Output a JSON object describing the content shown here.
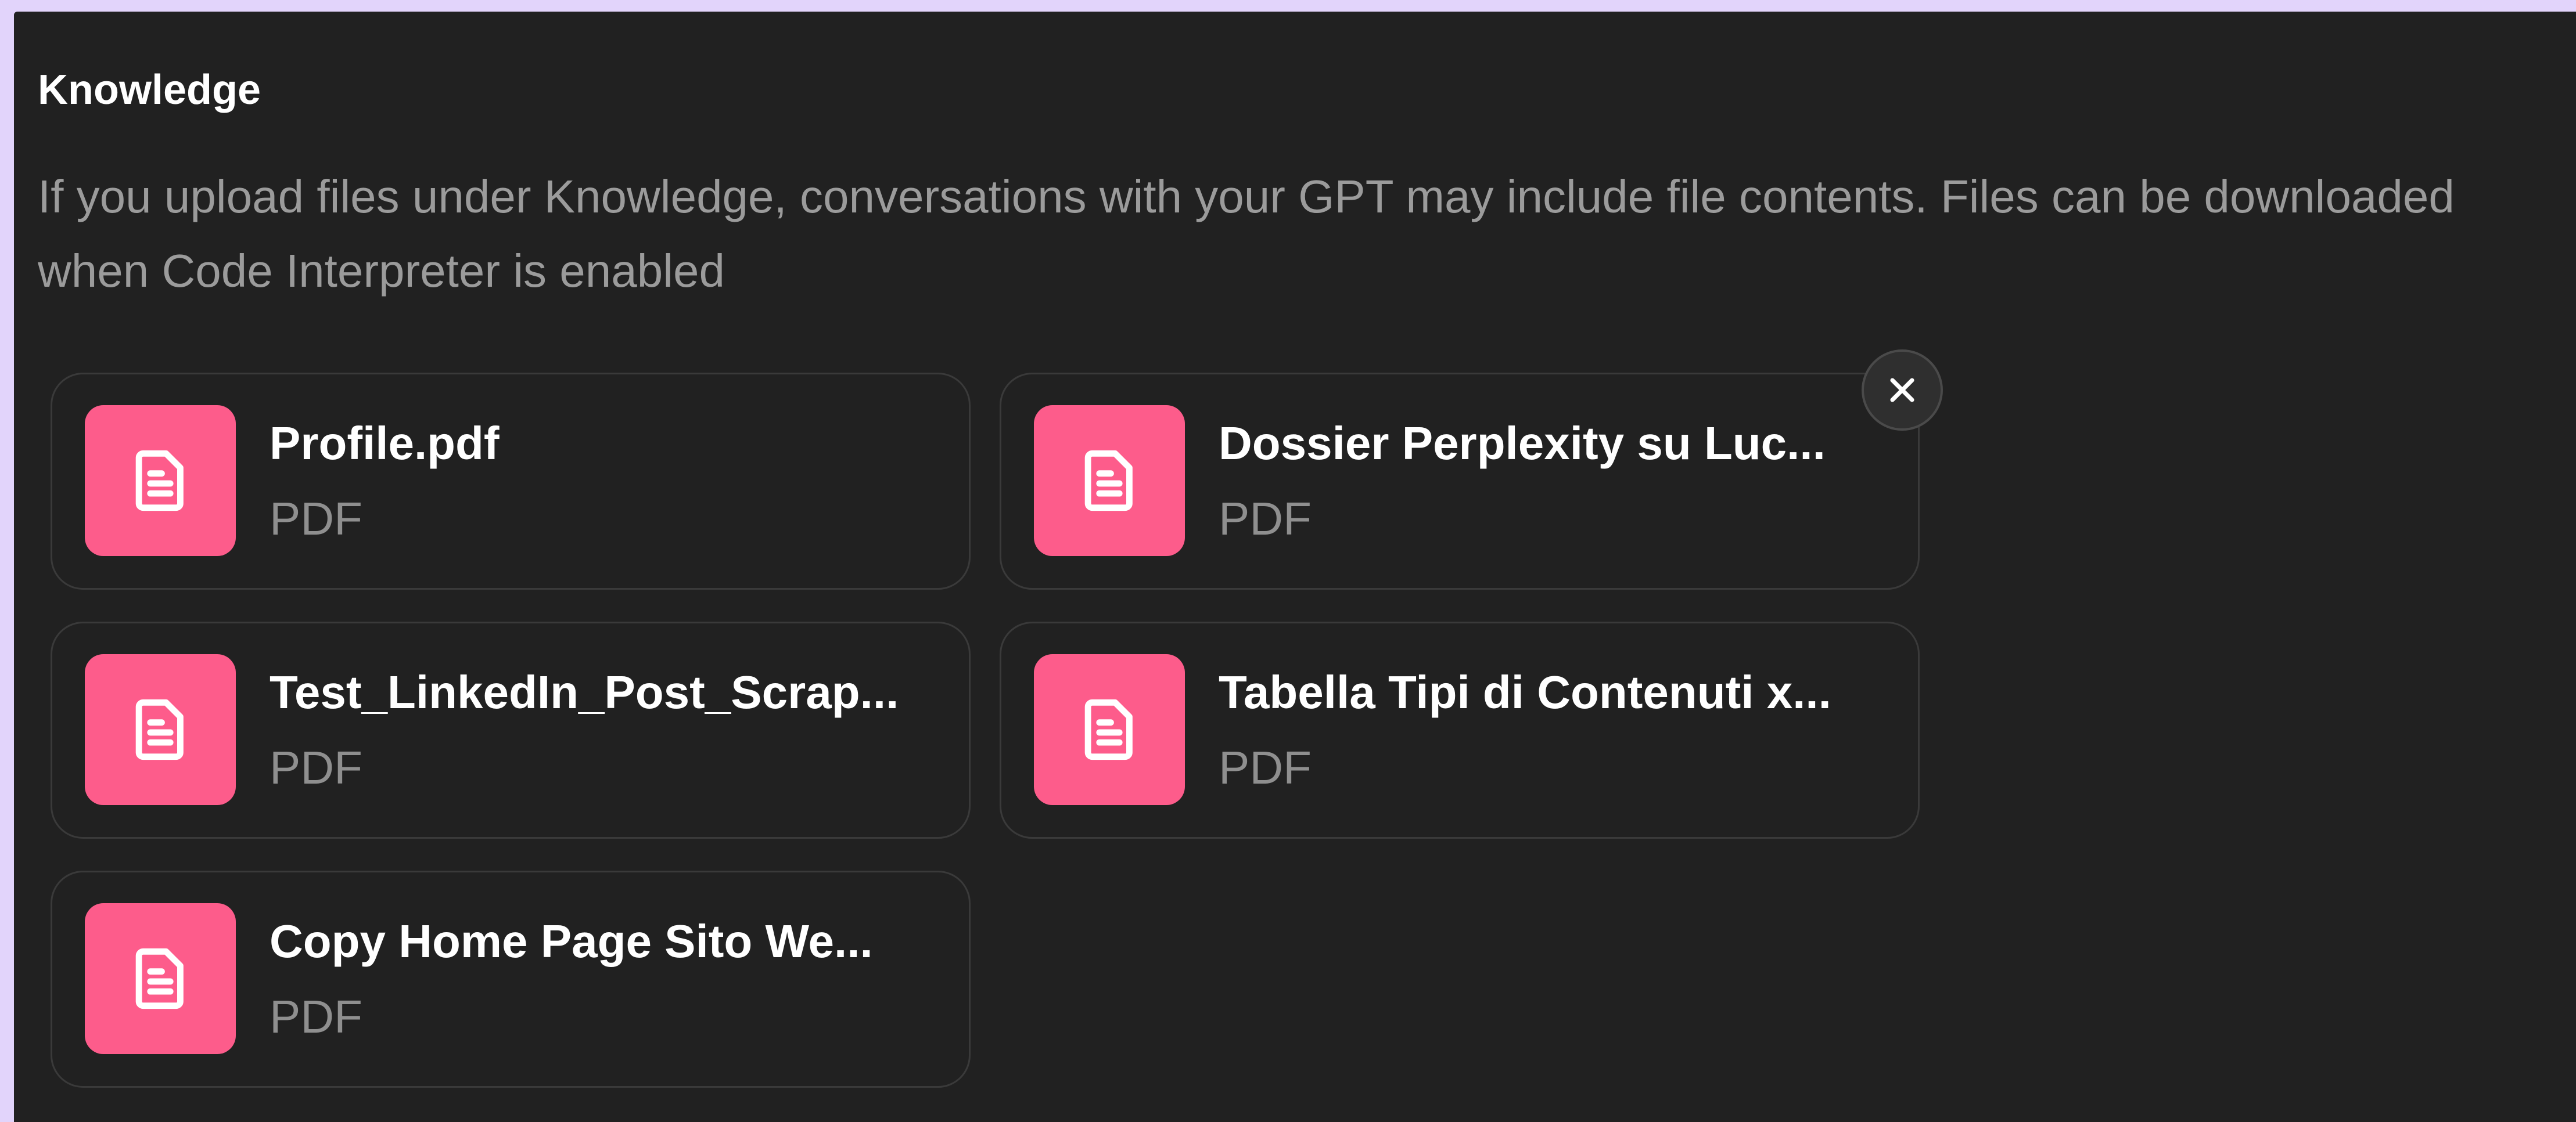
{
  "knowledge": {
    "title": "Knowledge",
    "description": "If you upload files under Knowledge, conversations with your GPT may include file contents. Files can be downloaded when Code Interpreter is enabled",
    "files": [
      {
        "name": "Profile.pdf",
        "type": "PDF"
      },
      {
        "name": "Dossier Perplexity su Luc...",
        "type": "PDF"
      },
      {
        "name": "Test_LinkedIn_Post_Scrap...",
        "type": "PDF"
      },
      {
        "name": "Tabella Tipi di Contenuti x...",
        "type": "PDF"
      },
      {
        "name": "Copy Home Page Sito We...",
        "type": "PDF"
      }
    ],
    "icon_color": "#fd5c8b",
    "file_icon": "document-icon",
    "remove_icon": "close-icon"
  }
}
